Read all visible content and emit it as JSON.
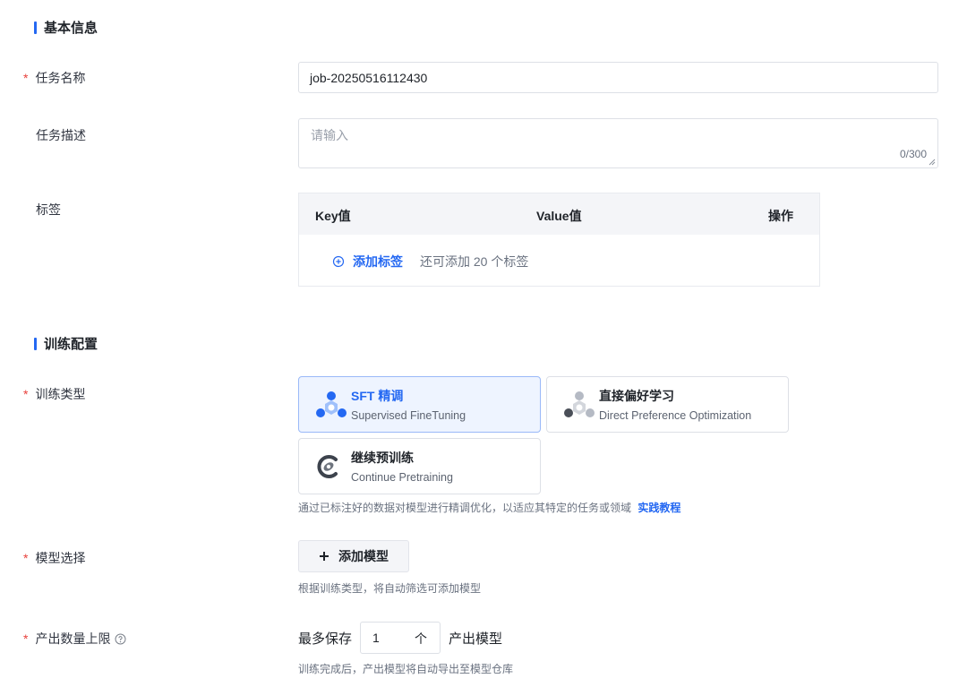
{
  "basic_info": {
    "section_title": "基本信息",
    "task_name": {
      "label": "任务名称",
      "required_mark": "*",
      "value": "job-20250516112430"
    },
    "task_desc": {
      "label": "任务描述",
      "placeholder": "请输入",
      "counter": "0/300"
    },
    "tags": {
      "label": "标签",
      "columns": [
        "Key值",
        "Value值",
        "操作"
      ],
      "add_label": "添加标签",
      "remaining_hint": "还可添加 20 个标签"
    }
  },
  "training_config": {
    "section_title": "训练配置",
    "train_type": {
      "label": "训练类型",
      "required_mark": "*",
      "options": [
        {
          "title": "SFT 精调",
          "subtitle": "Supervised FineTuning",
          "selected": true,
          "icon": "sft-icon"
        },
        {
          "title": "直接偏好学习",
          "subtitle": "Direct Preference Optimization",
          "selected": false,
          "icon": "dpo-icon"
        },
        {
          "title": "继续预训练",
          "subtitle": "Continue Pretraining",
          "selected": false,
          "icon": "pretrain-icon"
        }
      ],
      "description": "通过已标注好的数据对模型进行精调优化，以适应其特定的任务或领域",
      "tutorial_link": "实践教程"
    },
    "model_select": {
      "label": "模型选择",
      "required_mark": "*",
      "button_label": "添加模型",
      "button_icon": "plus-icon",
      "hint": "根据训练类型，将自动筛选可添加模型"
    },
    "output_limit": {
      "label": "产出数量上限",
      "required_mark": "*",
      "help_icon": "question-circle-icon",
      "prefix": "最多保存",
      "value": "1",
      "unit": "个",
      "suffix": "产出模型",
      "hint": "训练完成后，产出模型将自动导出至模型仓库"
    }
  },
  "colors": {
    "accent": "#2468f2",
    "required": "#e8403b",
    "selected_card_bg": "#eef4ff"
  }
}
